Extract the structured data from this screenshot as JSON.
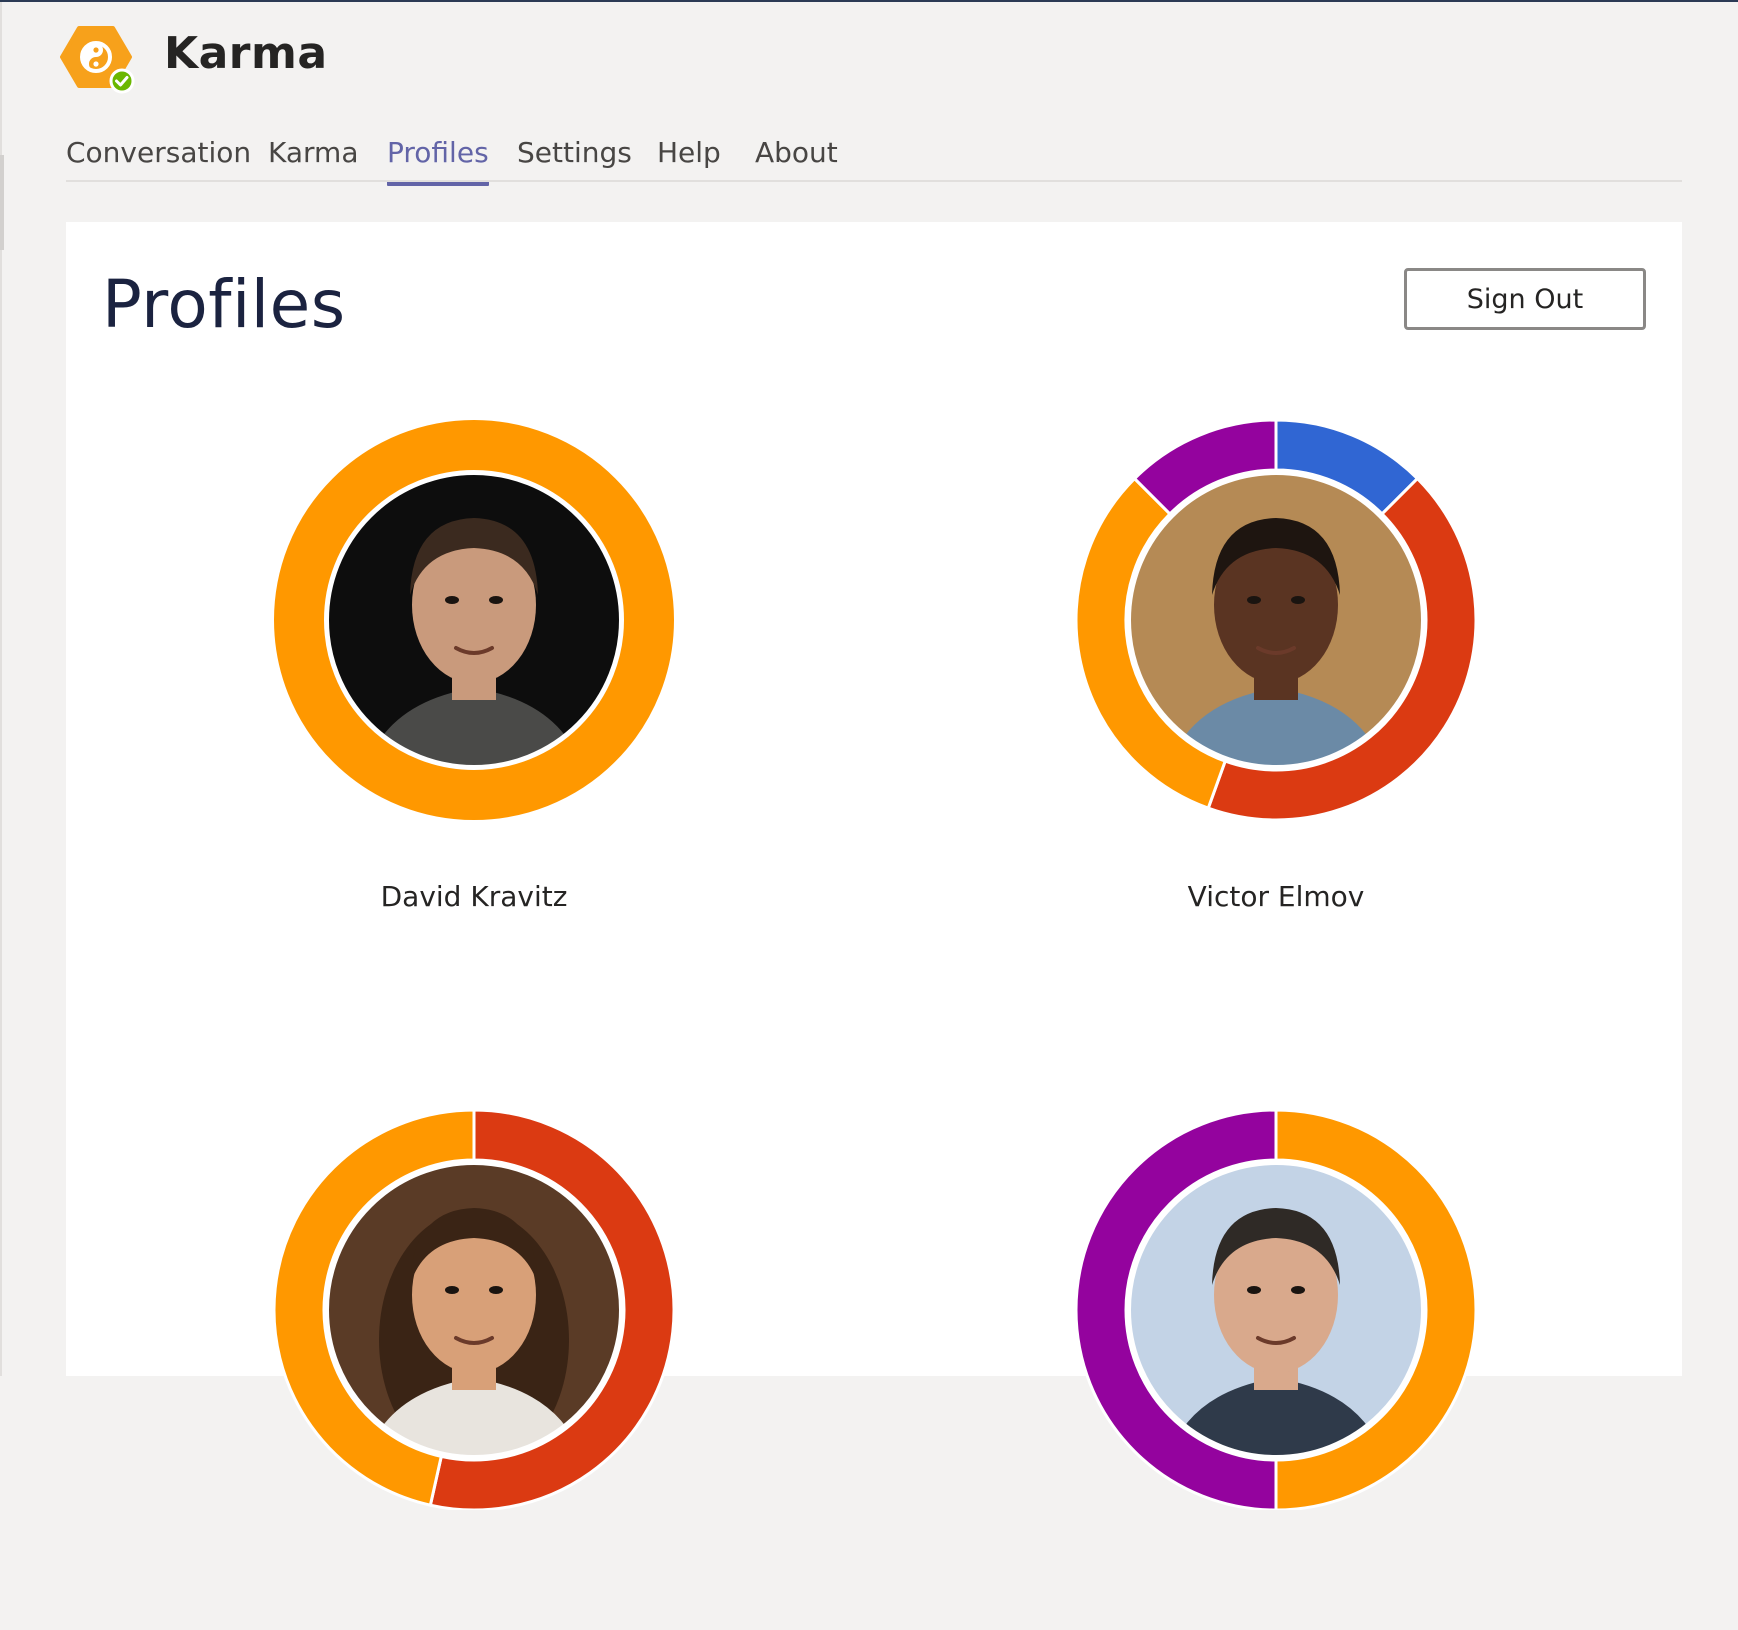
{
  "app": {
    "title": "Karma",
    "brand_color": "#f7a11b",
    "status_color": "#6bb700",
    "logo_icon": "yin-yang-hexagon-icon"
  },
  "tabs": [
    {
      "label": "Conversation",
      "active": false
    },
    {
      "label": "Karma",
      "active": false
    },
    {
      "label": "Profiles",
      "active": true
    },
    {
      "label": "Settings",
      "active": false
    },
    {
      "label": "Help",
      "active": false
    },
    {
      "label": "About",
      "active": false
    }
  ],
  "page": {
    "title": "Profiles",
    "sign_out_label": "Sign Out"
  },
  "colors": {
    "accent": "#6264a7",
    "orange": "#ff9800",
    "red": "#db3a12",
    "blue": "#3066d3",
    "purple": "#94039e"
  },
  "profiles": [
    {
      "name": "David Kravitz",
      "avatar": "man-dark-background",
      "segments": [
        {
          "color": "orange",
          "share": 1.0
        }
      ]
    },
    {
      "name": "Victor Elmov",
      "avatar": "man-smiling-street",
      "segments": [
        {
          "color": "blue",
          "share": 0.125
        },
        {
          "color": "red",
          "share": 0.43
        },
        {
          "color": "orange",
          "share": 0.32
        },
        {
          "color": "purple",
          "share": 0.125
        }
      ]
    },
    {
      "name": "",
      "avatar": "woman-on-phone",
      "segments": [
        {
          "color": "red",
          "share": 0.535
        },
        {
          "color": "orange",
          "share": 0.465
        }
      ]
    },
    {
      "name": "",
      "avatar": "man-profile-view",
      "segments": [
        {
          "color": "orange",
          "share": 0.5
        },
        {
          "color": "purple",
          "share": 0.5
        }
      ]
    }
  ]
}
